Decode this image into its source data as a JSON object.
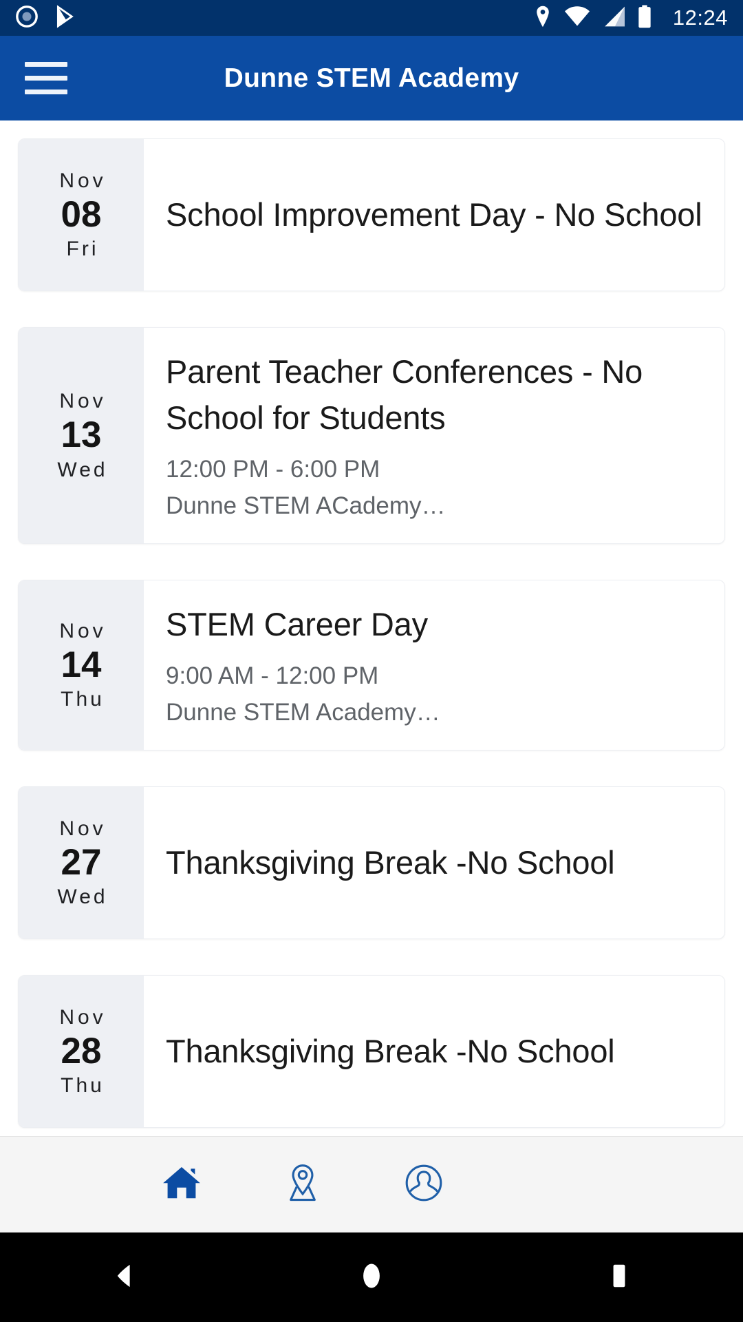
{
  "status_bar": {
    "time": "12:24",
    "icons": [
      "record-circle-icon",
      "play-store-icon",
      "location-icon",
      "wifi-icon",
      "cellular-signal-icon",
      "battery-icon"
    ],
    "background_color": "#02326b"
  },
  "app_bar": {
    "menu_icon": "hamburger-menu-icon",
    "title": "Dunne STEM Academy",
    "background_color": "#0c4ca3",
    "text_color": "#ffffff"
  },
  "events": [
    {
      "month": "Nov",
      "day": "08",
      "weekday": "Fri",
      "title": "School Improvement Day - No School",
      "time": "",
      "location": ""
    },
    {
      "month": "Nov",
      "day": "13",
      "weekday": "Wed",
      "title": "Parent Teacher Conferences - No School for Students",
      "time": "12:00 PM - 6:00 PM",
      "location": "Dunne STEM ACademy…"
    },
    {
      "month": "Nov",
      "day": "14",
      "weekday": "Thu",
      "title": "STEM Career Day",
      "time": "9:00 AM - 12:00 PM",
      "location": "Dunne STEM Academy…"
    },
    {
      "month": "Nov",
      "day": "27",
      "weekday": "Wed",
      "title": "Thanksgiving Break -No School",
      "time": "",
      "location": ""
    },
    {
      "month": "Nov",
      "day": "28",
      "weekday": "Thu",
      "title": "Thanksgiving Break -No School",
      "time": "",
      "location": ""
    }
  ],
  "tab_bar": {
    "background_color": "#f5f5f5",
    "accent_color": "#0c4ca3",
    "tabs": [
      {
        "name": "home",
        "icon": "home-icon",
        "active": true
      },
      {
        "name": "map",
        "icon": "map-pin-icon",
        "active": false
      },
      {
        "name": "profile",
        "icon": "profile-icon",
        "active": false
      }
    ]
  },
  "nav_bar": {
    "background_color": "#000000",
    "buttons": [
      {
        "name": "back",
        "icon": "back-triangle-icon"
      },
      {
        "name": "home",
        "icon": "home-circle-icon"
      },
      {
        "name": "recents",
        "icon": "recents-square-icon"
      }
    ]
  }
}
